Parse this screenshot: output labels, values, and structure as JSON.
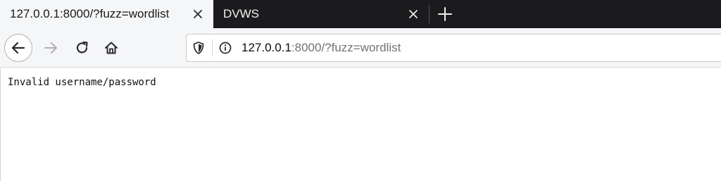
{
  "browser": {
    "tabs": [
      {
        "title": "127.0.0.1:8000/?fuzz=wordlist",
        "active": true
      },
      {
        "title": "DVWS",
        "active": false
      }
    ],
    "address_bar": {
      "host": "127.0.0.1",
      "rest": ":8000/?fuzz=wordlist"
    }
  },
  "page": {
    "message": "Invalid username/password"
  },
  "icons": {
    "back": "arrow-left-icon",
    "forward": "arrow-right-icon",
    "reload": "reload-icon",
    "home": "home-icon",
    "shield": "tracking-protection-shield-icon",
    "info": "site-info-icon",
    "close": "close-icon",
    "new_tab": "plus-icon"
  }
}
